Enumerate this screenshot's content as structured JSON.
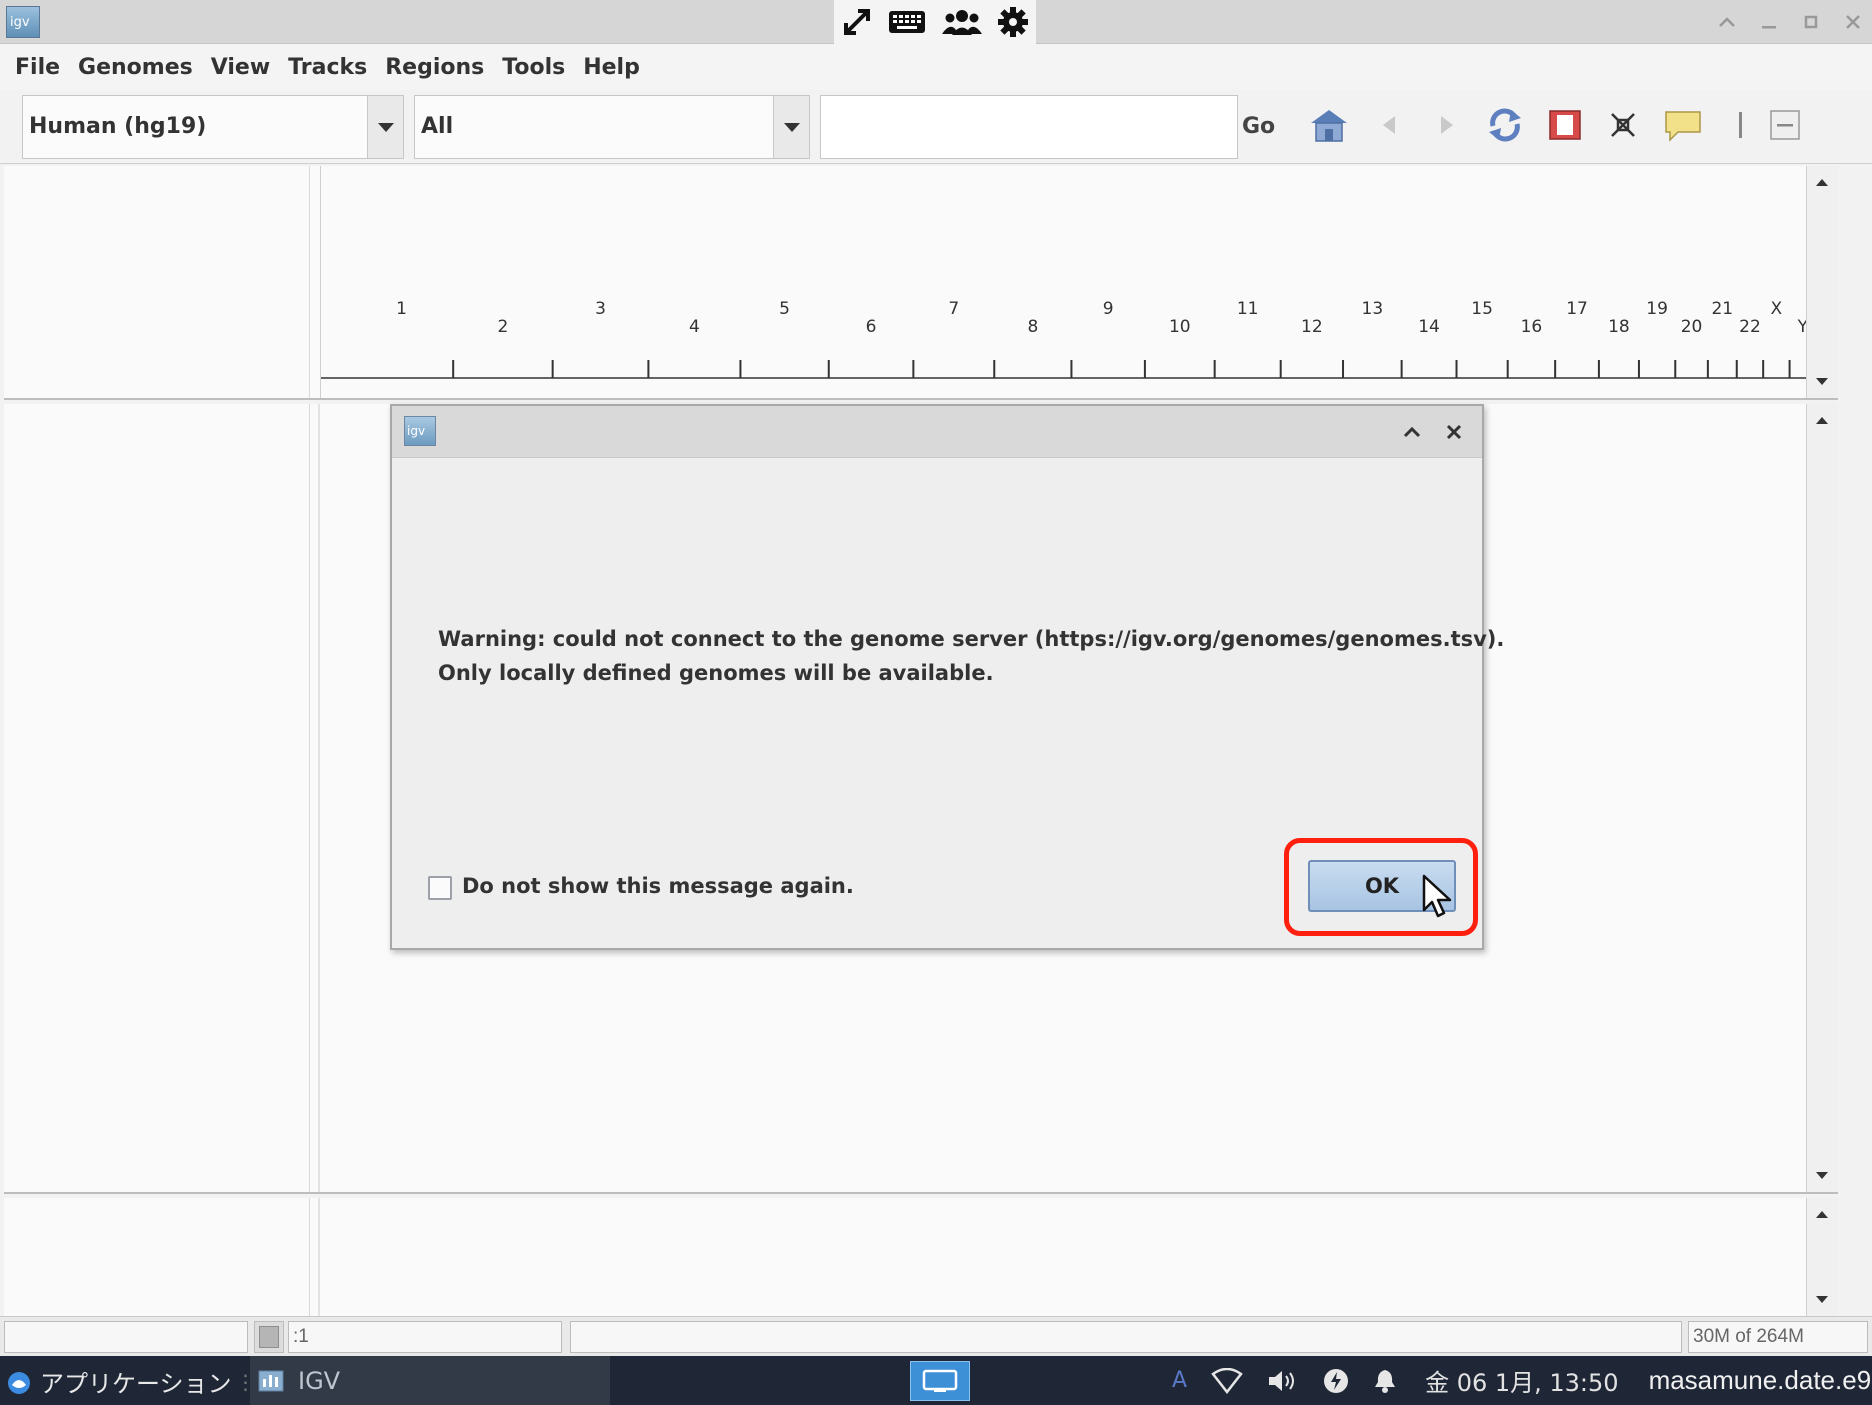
{
  "window": {
    "app_icon_label": "igv"
  },
  "menu": [
    "File",
    "Genomes",
    "View",
    "Tracks",
    "Regions",
    "Tools",
    "Help"
  ],
  "toolbar": {
    "genome_value": "Human (hg19)",
    "chromosome_value": "All",
    "locus_value": "",
    "go_label": "Go"
  },
  "ruler": {
    "chromosomes_top": [
      "1",
      "3",
      "5",
      "7",
      "9",
      "11",
      "13",
      "15",
      "17",
      "19",
      "21",
      "X"
    ],
    "chromosomes_bottom": [
      "2",
      "4",
      "6",
      "8",
      "10",
      "12",
      "14",
      "16",
      "18",
      "20",
      "22",
      "Y"
    ]
  },
  "dialog": {
    "icon_label": "igv",
    "message_line1": "Warning: could not connect to the genome server (https://igv.org/genomes/genomes.tsv).",
    "message_line2": "Only locally defined genomes will be available.",
    "checkbox_label": "Do not show this message again.",
    "checkbox_checked": false,
    "ok_label": "OK",
    "highlight_color": "#ff1f0f"
  },
  "statusbar": {
    "position_text": ":1",
    "message_text": "",
    "memory_text": "30M of 264M"
  },
  "taskbar": {
    "applications_label": "アプリケーション",
    "task_igv_label": "IGV",
    "clock": "金 06 1月, 13:50",
    "user": "masamune.date.e9",
    "input_method": "A"
  }
}
